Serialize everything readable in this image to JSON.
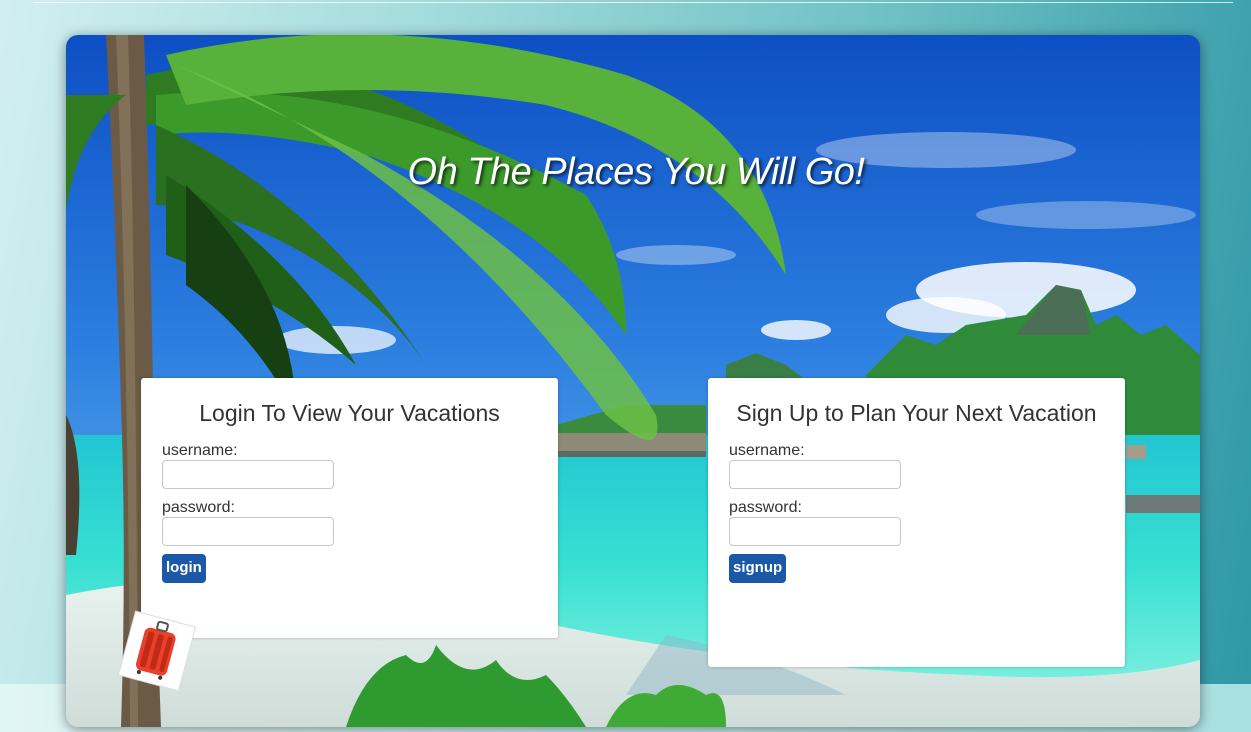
{
  "hero": {
    "title": "Oh The Places You Will Go!"
  },
  "login": {
    "heading": "Login To View Your Vacations",
    "username_label": "username:",
    "password_label": "password:",
    "username_value": "",
    "password_value": "",
    "button_label": "login"
  },
  "signup": {
    "heading": "Sign Up to Plan Your Next Vacation",
    "username_label": "username:",
    "password_label": "password:",
    "username_value": "",
    "password_value": "",
    "button_label": "signup"
  },
  "colors": {
    "button": "#1c58a8",
    "sea": "#2fd3cf",
    "sky": "#1f6fd6"
  },
  "icons": {
    "suitcase": "suitcase-icon"
  }
}
